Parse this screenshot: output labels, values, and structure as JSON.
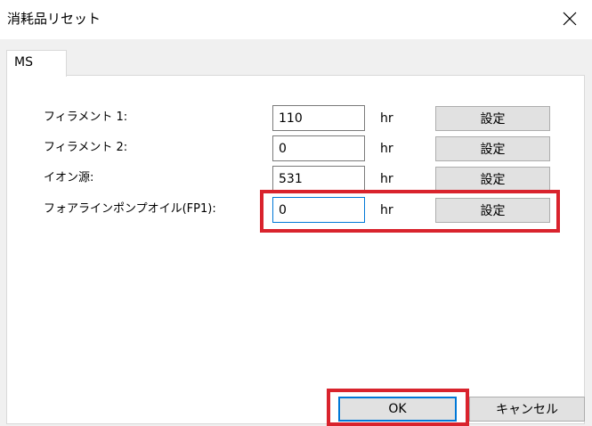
{
  "window": {
    "title": "消耗品リセット"
  },
  "tabs": [
    {
      "label": "MS"
    }
  ],
  "rows": [
    {
      "label": "フィラメント 1:",
      "value": "110",
      "unit": "hr",
      "button": "設定"
    },
    {
      "label": "フィラメント 2:",
      "value": "0",
      "unit": "hr",
      "button": "設定"
    },
    {
      "label": "イオン源:",
      "value": "531",
      "unit": "hr",
      "button": "設定"
    },
    {
      "label": "フォアラインポンプオイル(FP1):",
      "value": "0",
      "unit": "hr",
      "button": "設定"
    }
  ],
  "footer": {
    "ok_label": "OK",
    "cancel_label": "キャンセル"
  },
  "annotation_color": "#d9232d",
  "focus_color": "#0078d7",
  "icons": {
    "close": "close-icon"
  }
}
